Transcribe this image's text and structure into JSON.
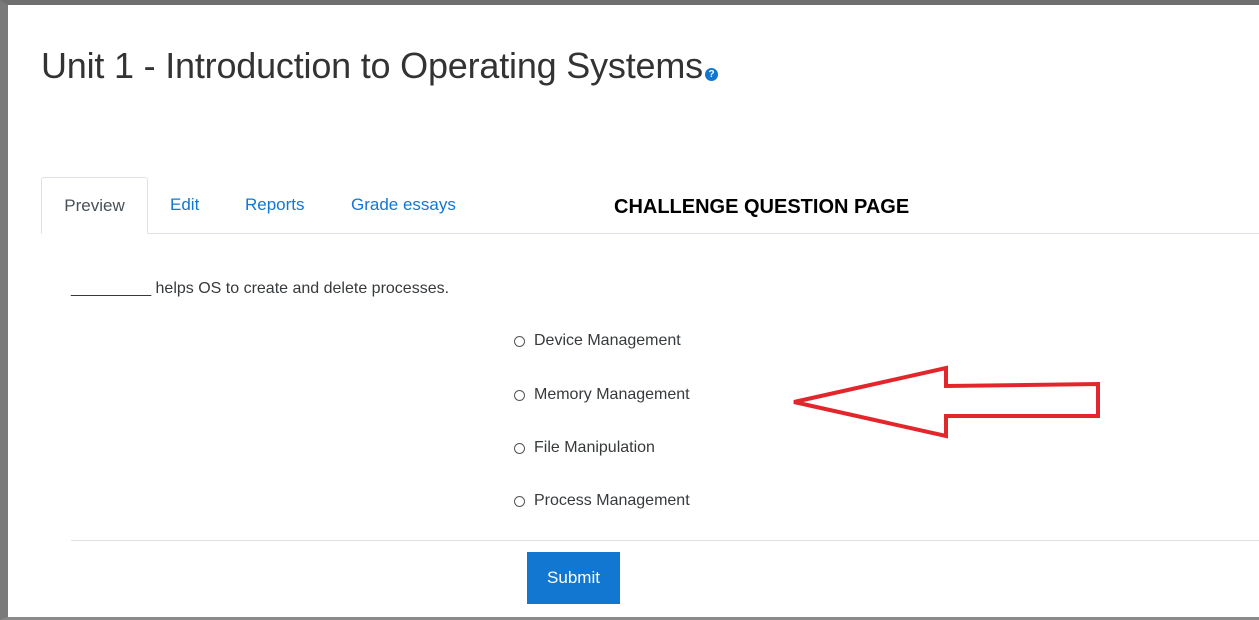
{
  "page": {
    "title": "Unit 1 - Introduction to Operating Systems",
    "help_icon": "?"
  },
  "tabs": [
    {
      "label": "Preview",
      "active": true
    },
    {
      "label": "Edit",
      "active": false
    },
    {
      "label": "Reports",
      "active": false
    },
    {
      "label": "Grade essays",
      "active": false
    }
  ],
  "annotation": {
    "label": "CHALLENGE QUESTION PAGE",
    "arrow_color": "#e3262b"
  },
  "question": {
    "text": "_________ helps OS to create and delete processes.",
    "options": [
      {
        "label": "Device Management",
        "selected": false
      },
      {
        "label": "Memory Management",
        "selected": false
      },
      {
        "label": "File Manipulation",
        "selected": false
      },
      {
        "label": "Process Management",
        "selected": false
      }
    ],
    "submit_label": "Submit"
  },
  "colors": {
    "accent": "#1177d1",
    "annotation": "#e3262b"
  }
}
